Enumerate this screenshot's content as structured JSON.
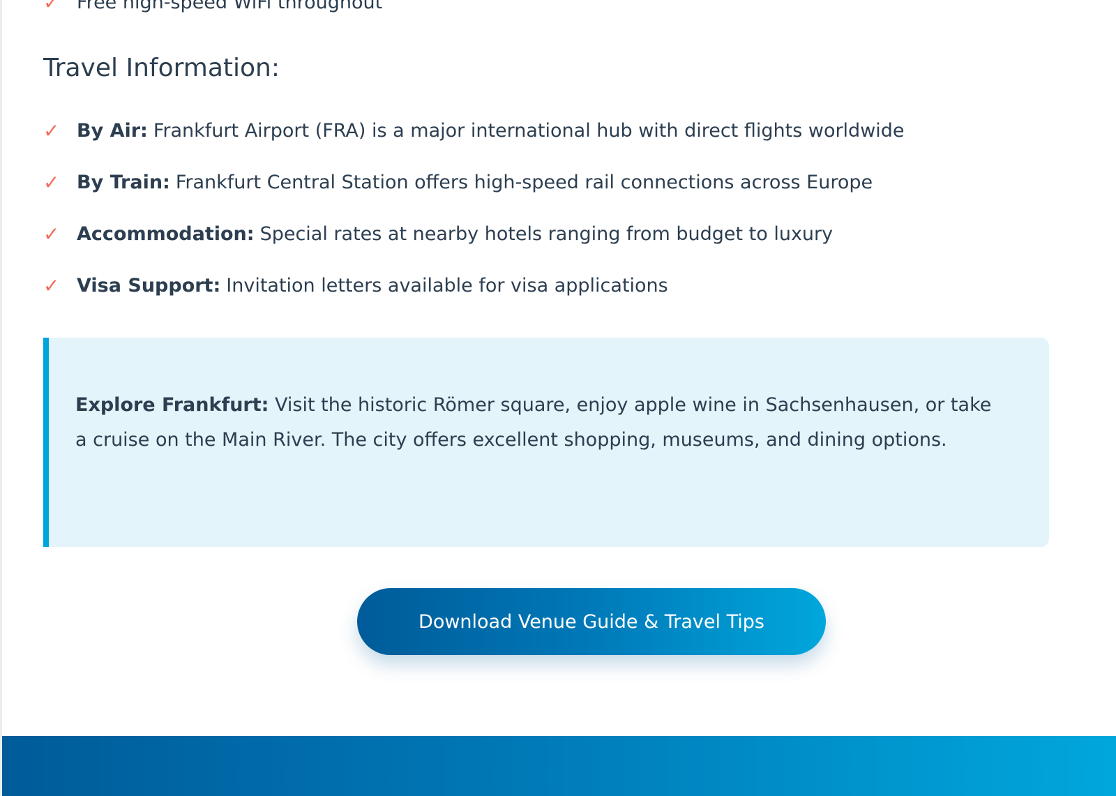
{
  "top_item": {
    "icon": "checkmark-icon",
    "text": "Free high-speed WiFi throughout"
  },
  "travel_section": {
    "title": "Travel Information:",
    "items": [
      {
        "label": "By Air:",
        "text": "Frankfurt Airport (FRA) is a major international hub with direct flights worldwide"
      },
      {
        "label": "By Train:",
        "text": "Frankfurt Central Station offers high-speed rail connections across Europe"
      },
      {
        "label": "Accommodation:",
        "text": "Special rates at nearby hotels ranging from budget to luxury"
      },
      {
        "label": "Visa Support:",
        "text": "Invitation letters available for visa applications"
      }
    ]
  },
  "callout": {
    "label": "Explore Frankfurt:",
    "text": "Visit the historic Römer square, enjoy apple wine in Sachsenhausen, or take a cruise on the Main River. The city offers excellent shopping, museums, and dining options."
  },
  "cta": {
    "label": "Download Venue Guide & Travel Tips"
  },
  "colors": {
    "check": "#f26b5b",
    "accent": "#00a6da",
    "brand_dark": "#005b99",
    "text": "#2c3e50",
    "callout_background": "#e3f4fa"
  }
}
